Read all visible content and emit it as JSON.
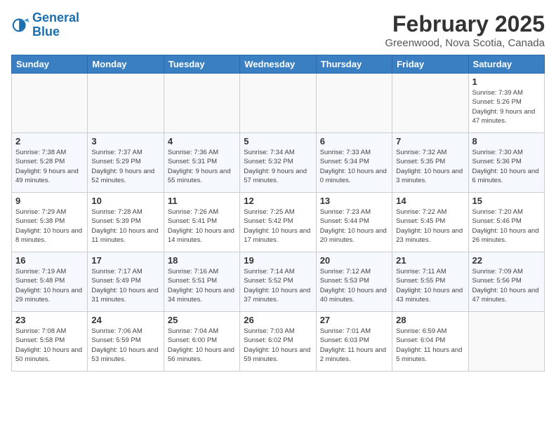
{
  "header": {
    "logo_line1": "General",
    "logo_line2": "Blue",
    "month": "February 2025",
    "location": "Greenwood, Nova Scotia, Canada"
  },
  "days_of_week": [
    "Sunday",
    "Monday",
    "Tuesday",
    "Wednesday",
    "Thursday",
    "Friday",
    "Saturday"
  ],
  "weeks": [
    [
      {
        "day": "",
        "info": ""
      },
      {
        "day": "",
        "info": ""
      },
      {
        "day": "",
        "info": ""
      },
      {
        "day": "",
        "info": ""
      },
      {
        "day": "",
        "info": ""
      },
      {
        "day": "",
        "info": ""
      },
      {
        "day": "1",
        "info": "Sunrise: 7:39 AM\nSunset: 5:26 PM\nDaylight: 9 hours and 47 minutes."
      }
    ],
    [
      {
        "day": "2",
        "info": "Sunrise: 7:38 AM\nSunset: 5:28 PM\nDaylight: 9 hours and 49 minutes."
      },
      {
        "day": "3",
        "info": "Sunrise: 7:37 AM\nSunset: 5:29 PM\nDaylight: 9 hours and 52 minutes."
      },
      {
        "day": "4",
        "info": "Sunrise: 7:36 AM\nSunset: 5:31 PM\nDaylight: 9 hours and 55 minutes."
      },
      {
        "day": "5",
        "info": "Sunrise: 7:34 AM\nSunset: 5:32 PM\nDaylight: 9 hours and 57 minutes."
      },
      {
        "day": "6",
        "info": "Sunrise: 7:33 AM\nSunset: 5:34 PM\nDaylight: 10 hours and 0 minutes."
      },
      {
        "day": "7",
        "info": "Sunrise: 7:32 AM\nSunset: 5:35 PM\nDaylight: 10 hours and 3 minutes."
      },
      {
        "day": "8",
        "info": "Sunrise: 7:30 AM\nSunset: 5:36 PM\nDaylight: 10 hours and 6 minutes."
      }
    ],
    [
      {
        "day": "9",
        "info": "Sunrise: 7:29 AM\nSunset: 5:38 PM\nDaylight: 10 hours and 8 minutes."
      },
      {
        "day": "10",
        "info": "Sunrise: 7:28 AM\nSunset: 5:39 PM\nDaylight: 10 hours and 11 minutes."
      },
      {
        "day": "11",
        "info": "Sunrise: 7:26 AM\nSunset: 5:41 PM\nDaylight: 10 hours and 14 minutes."
      },
      {
        "day": "12",
        "info": "Sunrise: 7:25 AM\nSunset: 5:42 PM\nDaylight: 10 hours and 17 minutes."
      },
      {
        "day": "13",
        "info": "Sunrise: 7:23 AM\nSunset: 5:44 PM\nDaylight: 10 hours and 20 minutes."
      },
      {
        "day": "14",
        "info": "Sunrise: 7:22 AM\nSunset: 5:45 PM\nDaylight: 10 hours and 23 minutes."
      },
      {
        "day": "15",
        "info": "Sunrise: 7:20 AM\nSunset: 5:46 PM\nDaylight: 10 hours and 26 minutes."
      }
    ],
    [
      {
        "day": "16",
        "info": "Sunrise: 7:19 AM\nSunset: 5:48 PM\nDaylight: 10 hours and 29 minutes."
      },
      {
        "day": "17",
        "info": "Sunrise: 7:17 AM\nSunset: 5:49 PM\nDaylight: 10 hours and 31 minutes."
      },
      {
        "day": "18",
        "info": "Sunrise: 7:16 AM\nSunset: 5:51 PM\nDaylight: 10 hours and 34 minutes."
      },
      {
        "day": "19",
        "info": "Sunrise: 7:14 AM\nSunset: 5:52 PM\nDaylight: 10 hours and 37 minutes."
      },
      {
        "day": "20",
        "info": "Sunrise: 7:12 AM\nSunset: 5:53 PM\nDaylight: 10 hours and 40 minutes."
      },
      {
        "day": "21",
        "info": "Sunrise: 7:11 AM\nSunset: 5:55 PM\nDaylight: 10 hours and 43 minutes."
      },
      {
        "day": "22",
        "info": "Sunrise: 7:09 AM\nSunset: 5:56 PM\nDaylight: 10 hours and 47 minutes."
      }
    ],
    [
      {
        "day": "23",
        "info": "Sunrise: 7:08 AM\nSunset: 5:58 PM\nDaylight: 10 hours and 50 minutes."
      },
      {
        "day": "24",
        "info": "Sunrise: 7:06 AM\nSunset: 5:59 PM\nDaylight: 10 hours and 53 minutes."
      },
      {
        "day": "25",
        "info": "Sunrise: 7:04 AM\nSunset: 6:00 PM\nDaylight: 10 hours and 56 minutes."
      },
      {
        "day": "26",
        "info": "Sunrise: 7:03 AM\nSunset: 6:02 PM\nDaylight: 10 hours and 59 minutes."
      },
      {
        "day": "27",
        "info": "Sunrise: 7:01 AM\nSunset: 6:03 PM\nDaylight: 11 hours and 2 minutes."
      },
      {
        "day": "28",
        "info": "Sunrise: 6:59 AM\nSunset: 6:04 PM\nDaylight: 11 hours and 5 minutes."
      },
      {
        "day": "",
        "info": ""
      }
    ]
  ]
}
